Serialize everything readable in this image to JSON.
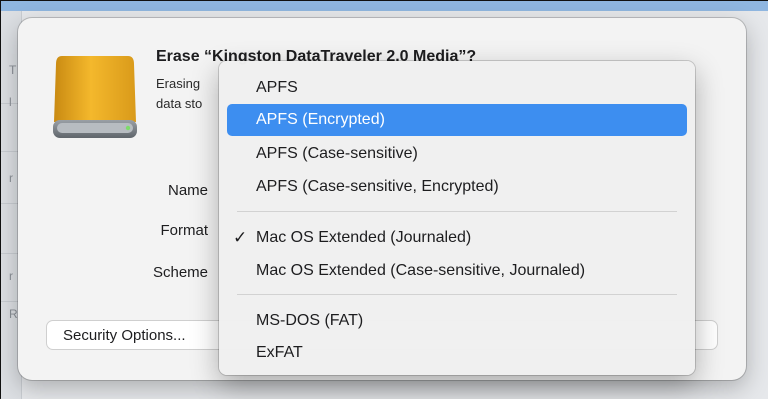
{
  "dialog": {
    "title": "Erase “Kingston DataTraveler 2.0 Media”?",
    "subtitle_line1": "Erasing",
    "subtitle_line2": "data sto",
    "labels": {
      "name": "Name",
      "format": "Format",
      "scheme": "Scheme"
    },
    "security_button": "Security Options..."
  },
  "format_menu": {
    "items": [
      {
        "label": "APFS",
        "checked": false,
        "highlighted": false
      },
      {
        "label": "APFS (Encrypted)",
        "checked": false,
        "highlighted": true
      },
      {
        "label": "APFS (Case-sensitive)",
        "checked": false,
        "highlighted": false
      },
      {
        "label": "APFS (Case-sensitive, Encrypted)",
        "checked": false,
        "highlighted": false
      },
      {
        "label": "Mac OS Extended (Journaled)",
        "checked": true,
        "highlighted": false
      },
      {
        "label": "Mac OS Extended (Case-sensitive, Journaled)",
        "checked": false,
        "highlighted": false
      },
      {
        "label": "MS-DOS (FAT)",
        "checked": false,
        "highlighted": false
      },
      {
        "label": "ExFAT",
        "checked": false,
        "highlighted": false
      }
    ],
    "check_glyph": "✓",
    "highlight_color": "#3d8ef0"
  },
  "background_window": {
    "sidebar_letters": [
      "T",
      "l",
      "r",
      "r",
      "R"
    ]
  },
  "icons": {
    "drive": "external-drive-icon"
  }
}
